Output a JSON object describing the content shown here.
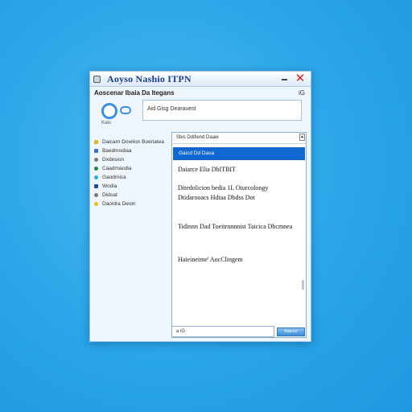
{
  "window": {
    "title": "Aoyso Nashio ITPN"
  },
  "menu": {
    "left_label": "Aoscenar Ibaia Da Itegans",
    "right_label": "iG"
  },
  "logo": {
    "caption": "Kalo"
  },
  "address_input": {
    "value": "Aid Gisg Dearauest"
  },
  "nav_items": [
    {
      "label": "Daicarn Dowlion Boeriatea",
      "color": "#e0b23a"
    },
    {
      "label": "Baedmodiaa",
      "color": "#3b6fbf"
    },
    {
      "label": "Dxdesion",
      "color": "#7a7a7a"
    },
    {
      "label": "Caadmacdia",
      "color": "#2a8a3c"
    },
    {
      "label": "Gaodmica",
      "color": "#24b3c4"
    },
    {
      "label": "Wodia",
      "color": "#1f4b9a"
    },
    {
      "label": "Didoat",
      "color": "#7a7a7a"
    },
    {
      "label": "Daoidra Deoin",
      "color": "#e4c01e"
    }
  ],
  "panel": {
    "header": "Sbis Ddifiend Daaie",
    "selected_row": "Gaicd Dd Dasa",
    "paragraphs": [
      "Daiarce Elia DbITBIT",
      "Ditedolicion bedia 1L Oiurcolongy Dtidarooacs Hdtaa Dbdss Dot",
      "Tidinnn Dad Toeitrnnnnist Taicica Dbcmnea",
      "Haieineime' AocClingem"
    ]
  },
  "search": {
    "value": "a   iG"
  },
  "go_button": {
    "label": "Ioacce"
  }
}
